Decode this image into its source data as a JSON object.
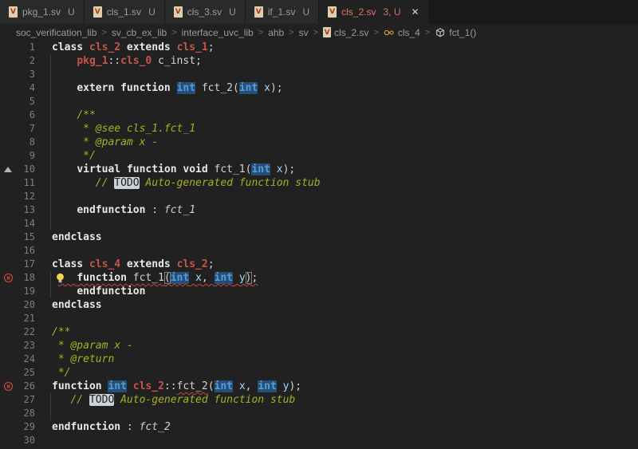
{
  "theme": {
    "editor_bg": "#212121",
    "tabbar_bg": "#191919",
    "tab_bg": "#2a2a2a",
    "tab_active_bg": "#212121",
    "tab_text": "#9d9d9d",
    "tab_active_text": "#e0756b",
    "error_red": "#c4473a",
    "type_blue": "#569cd6",
    "class_red": "#c75549",
    "comment_olive": "#a6b022",
    "word_highlight_bg": "#264f78",
    "lightbulb_yellow": "#f3d44c",
    "class_icon_orange": "#e8a33d"
  },
  "tabs": [
    {
      "label": "pkg_1.sv",
      "status": "U",
      "icon": "sv-file-icon",
      "active": false
    },
    {
      "label": "cls_1.sv",
      "status": "U",
      "icon": "sv-file-icon",
      "active": false
    },
    {
      "label": "cls_3.sv",
      "status": "U",
      "icon": "sv-file-icon",
      "active": false
    },
    {
      "label": "if_1.sv",
      "status": "U",
      "icon": "sv-file-icon",
      "active": false
    },
    {
      "label": "cls_2.sv",
      "status": "3, U",
      "icon": "sv-file-icon",
      "active": true,
      "close_glyph": "✕"
    }
  ],
  "file_icon_letter": "V",
  "breadcrumbs": {
    "separator": ">",
    "items": [
      {
        "t": "soc_verification_lib"
      },
      {
        "t": "sv_cb_ex_lib"
      },
      {
        "t": "interface_uvc_lib"
      },
      {
        "t": "ahb"
      },
      {
        "t": "sv"
      },
      {
        "t": "cls_2.sv",
        "icon": "file"
      },
      {
        "t": "cls_4",
        "icon": "class"
      },
      {
        "t": "fct_1()",
        "icon": "method"
      }
    ]
  },
  "lines": [
    {
      "n": 1,
      "toks": [
        [
          "kw",
          "class "
        ],
        [
          "cls",
          "cls_2"
        ],
        [
          "kw",
          " extends "
        ],
        [
          "cls",
          "cls_1"
        ],
        [
          "pln",
          ";"
        ]
      ]
    },
    {
      "n": 2,
      "guide": 1,
      "toks": [
        [
          "pln",
          "    "
        ],
        [
          "cls",
          "pkg_1"
        ],
        [
          "pln",
          "::"
        ],
        [
          "cls",
          "cls_0"
        ],
        [
          "pln",
          " c_inst;"
        ]
      ]
    },
    {
      "n": 3,
      "guide": 1,
      "toks": []
    },
    {
      "n": 4,
      "guide": 1,
      "toks": [
        [
          "pln",
          "    "
        ],
        [
          "kw",
          "extern function "
        ],
        [
          "typ hl",
          "int"
        ],
        [
          "pln",
          " fct_2("
        ],
        [
          "typ hl",
          "int"
        ],
        [
          "pln",
          " "
        ],
        [
          "var",
          "x"
        ],
        [
          "pln",
          ");"
        ]
      ]
    },
    {
      "n": 5,
      "guide": 1,
      "toks": []
    },
    {
      "n": 6,
      "guide": 1,
      "toks": [
        [
          "pln",
          "    "
        ],
        [
          "cmt",
          "/**"
        ]
      ]
    },
    {
      "n": 7,
      "guide": 1,
      "toks": [
        [
          "pln",
          "    "
        ],
        [
          "cmt",
          " * @see cls_1.fct_1"
        ]
      ]
    },
    {
      "n": 8,
      "guide": 1,
      "toks": [
        [
          "pln",
          "    "
        ],
        [
          "cmt",
          " * @param x -"
        ]
      ]
    },
    {
      "n": 9,
      "guide": 1,
      "toks": [
        [
          "pln",
          "    "
        ],
        [
          "cmt",
          " */"
        ]
      ]
    },
    {
      "n": 10,
      "g": "tri",
      "guide": 1,
      "toks": [
        [
          "pln",
          "    "
        ],
        [
          "kw",
          "virtual function void "
        ],
        [
          "pln",
          "fct_1("
        ],
        [
          "typ hl",
          "int"
        ],
        [
          "pln",
          " "
        ],
        [
          "var",
          "x"
        ],
        [
          "pln",
          ");"
        ]
      ]
    },
    {
      "n": 11,
      "guide": 1,
      "toks": [
        [
          "pln",
          "       "
        ],
        [
          "cmt",
          "// "
        ],
        [
          "todo",
          "TODO"
        ],
        [
          "cmt",
          " Auto-generated function stub"
        ]
      ]
    },
    {
      "n": 12,
      "guide": 1,
      "toks": []
    },
    {
      "n": 13,
      "guide": 1,
      "toks": [
        [
          "pln",
          "    "
        ],
        [
          "kw",
          "endfunction"
        ],
        [
          "pln",
          " : "
        ],
        [
          "lbl",
          "fct_1"
        ]
      ]
    },
    {
      "n": 14,
      "guide": 1,
      "toks": []
    },
    {
      "n": 15,
      "toks": [
        [
          "kw",
          "endclass"
        ]
      ]
    },
    {
      "n": 16,
      "toks": []
    },
    {
      "n": 17,
      "toks": [
        [
          "kw",
          "class "
        ],
        [
          "cls",
          "cls_4"
        ],
        [
          "kw",
          " extends "
        ],
        [
          "cls",
          "cls_2"
        ],
        [
          "pln",
          ";"
        ]
      ]
    },
    {
      "n": 18,
      "g": "err",
      "bulb": 1,
      "guide": 1,
      "toks": [
        [
          "pln",
          " "
        ],
        [
          "pln sq",
          "   "
        ],
        [
          "kw sq",
          "function "
        ],
        [
          "pln sq",
          "fct_1"
        ],
        [
          "brk sq",
          "("
        ],
        [
          "typ hl sq",
          "int"
        ],
        [
          "pln sq",
          " "
        ],
        [
          "var sq",
          "x"
        ],
        [
          "pln sq",
          ", "
        ],
        [
          "typ hl sq",
          "int"
        ],
        [
          "pln sq",
          " "
        ],
        [
          "var sq",
          "y"
        ],
        [
          "brk sq",
          ")"
        ],
        [
          "pln sq",
          ";"
        ]
      ]
    },
    {
      "n": 19,
      "guide": 1,
      "toks": [
        [
          "pln",
          "    "
        ],
        [
          "kw",
          "endfunction"
        ]
      ]
    },
    {
      "n": 20,
      "toks": [
        [
          "kw",
          "endclass"
        ]
      ]
    },
    {
      "n": 21,
      "toks": []
    },
    {
      "n": 22,
      "toks": [
        [
          "cmt",
          "/**"
        ]
      ]
    },
    {
      "n": 23,
      "toks": [
        [
          "cmt",
          " * @param x -"
        ]
      ]
    },
    {
      "n": 24,
      "toks": [
        [
          "cmt",
          " * @return"
        ]
      ]
    },
    {
      "n": 25,
      "toks": [
        [
          "cmt",
          " */"
        ]
      ]
    },
    {
      "n": 26,
      "g": "err",
      "toks": [
        [
          "kw",
          "function "
        ],
        [
          "typ hl",
          "int"
        ],
        [
          "pln",
          " "
        ],
        [
          "cls",
          "cls_2"
        ],
        [
          "pln",
          "::"
        ],
        [
          "pln sq",
          "fct_2"
        ],
        [
          "pln",
          "("
        ],
        [
          "typ hl",
          "int"
        ],
        [
          "pln",
          " "
        ],
        [
          "var",
          "x"
        ],
        [
          "pln",
          ", "
        ],
        [
          "typ hl",
          "int"
        ],
        [
          "pln",
          " "
        ],
        [
          "var",
          "y"
        ],
        [
          "pln",
          ");"
        ]
      ]
    },
    {
      "n": 27,
      "guide": 1,
      "toks": [
        [
          "pln",
          "   "
        ],
        [
          "cmt",
          "// "
        ],
        [
          "todo",
          "TODO"
        ],
        [
          "cmt",
          " Auto-generated function stub"
        ]
      ]
    },
    {
      "n": 28,
      "guide": 1,
      "toks": []
    },
    {
      "n": 29,
      "toks": [
        [
          "kw",
          "endfunction"
        ],
        [
          "pln",
          " : "
        ],
        [
          "lbl",
          "fct_2"
        ]
      ]
    },
    {
      "n": 30,
      "toks": []
    }
  ]
}
